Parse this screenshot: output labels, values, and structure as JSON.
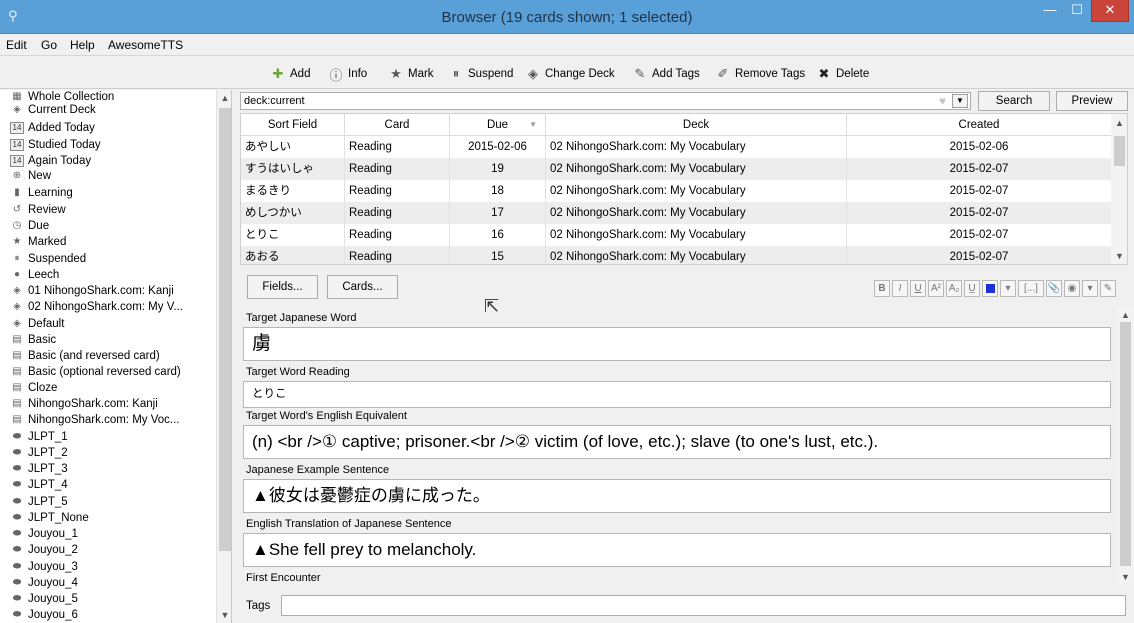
{
  "window": {
    "title": "Browser (19 cards shown; 1 selected)",
    "min_glyph": "—",
    "max_glyph": "☐",
    "close_glyph": "✕"
  },
  "menu": [
    "Edit",
    "Go",
    "Help",
    "AwesomeTTS"
  ],
  "toolbar": [
    {
      "label": "Add",
      "icon": "add-icon"
    },
    {
      "label": "Info",
      "icon": "info-icon"
    },
    {
      "label": "Mark",
      "icon": "star-icon"
    },
    {
      "label": "Suspend",
      "icon": "pause-icon"
    },
    {
      "label": "Change Deck",
      "icon": "deck-icon"
    },
    {
      "label": "Add Tags",
      "icon": "tag-icon"
    },
    {
      "label": "Remove Tags",
      "icon": "remove-tag-icon"
    },
    {
      "label": "Delete",
      "icon": "delete-icon"
    }
  ],
  "sidebar": {
    "items": [
      {
        "label": "Whole Collection",
        "icon": "collection-icon"
      },
      {
        "label": "Current Deck",
        "icon": "deck-icon"
      },
      {
        "label": "Added Today",
        "icon": "calendar-icon",
        "badge": "14"
      },
      {
        "label": "Studied Today",
        "icon": "calendar-icon",
        "badge": "14"
      },
      {
        "label": "Again Today",
        "icon": "calendar-icon",
        "badge": "14"
      },
      {
        "label": "New",
        "icon": "new-icon"
      },
      {
        "label": "Learning",
        "icon": "learning-icon"
      },
      {
        "label": "Review",
        "icon": "review-icon"
      },
      {
        "label": "Due",
        "icon": "clock-icon"
      },
      {
        "label": "Marked",
        "icon": "star-icon"
      },
      {
        "label": "Suspended",
        "icon": "pause-icon"
      },
      {
        "label": "Leech",
        "icon": "leech-icon"
      },
      {
        "label": "01 NihongoShark.com: Kanji",
        "icon": "deck-icon"
      },
      {
        "label": "02 NihongoShark.com: My V...",
        "icon": "deck-icon"
      },
      {
        "label": "Default",
        "icon": "deck-icon"
      },
      {
        "label": "Basic",
        "icon": "note-type-icon"
      },
      {
        "label": "Basic (and reversed card)",
        "icon": "note-type-icon"
      },
      {
        "label": "Basic (optional reversed card)",
        "icon": "note-type-icon"
      },
      {
        "label": "Cloze",
        "icon": "note-type-icon"
      },
      {
        "label": "NihongoShark.com: Kanji",
        "icon": "note-type-icon"
      },
      {
        "label": "NihongoShark.com: My Voc...",
        "icon": "note-type-icon"
      },
      {
        "label": "JLPT_1",
        "icon": "tag-icon"
      },
      {
        "label": "JLPT_2",
        "icon": "tag-icon"
      },
      {
        "label": "JLPT_3",
        "icon": "tag-icon"
      },
      {
        "label": "JLPT_4",
        "icon": "tag-icon"
      },
      {
        "label": "JLPT_5",
        "icon": "tag-icon"
      },
      {
        "label": "JLPT_None",
        "icon": "tag-icon"
      },
      {
        "label": "Jouyou_1",
        "icon": "tag-icon"
      },
      {
        "label": "Jouyou_2",
        "icon": "tag-icon"
      },
      {
        "label": "Jouyou_3",
        "icon": "tag-icon"
      },
      {
        "label": "Jouyou_4",
        "icon": "tag-icon"
      },
      {
        "label": "Jouyou_5",
        "icon": "tag-icon"
      },
      {
        "label": "Jouyou_6",
        "icon": "tag-icon"
      }
    ]
  },
  "search": {
    "value": "deck:current",
    "button": "Search",
    "preview": "Preview"
  },
  "table": {
    "headers": [
      "Sort Field",
      "Card",
      "Due",
      "Deck",
      "Created"
    ],
    "rows": [
      [
        "あやしい",
        "Reading",
        "2015-02-06",
        "02 NihongoShark.com: My Vocabulary",
        "2015-02-06"
      ],
      [
        "すうはいしゃ",
        "Reading",
        "19",
        "02 NihongoShark.com: My Vocabulary",
        "2015-02-07"
      ],
      [
        "まるきり",
        "Reading",
        "18",
        "02 NihongoShark.com: My Vocabulary",
        "2015-02-07"
      ],
      [
        "めしつかい",
        "Reading",
        "17",
        "02 NihongoShark.com: My Vocabulary",
        "2015-02-07"
      ],
      [
        "とりこ",
        "Reading",
        "16",
        "02 NihongoShark.com: My Vocabulary",
        "2015-02-07"
      ],
      [
        "あおる",
        "Reading",
        "15",
        "02 NihongoShark.com: My Vocabulary",
        "2015-02-07"
      ]
    ]
  },
  "editor": {
    "fields_button": "Fields...",
    "cards_button": "Cards...",
    "format_buttons": [
      "B",
      "I",
      "U",
      "A²",
      "A₂",
      "U̲",
      "■",
      "▾",
      "[...]",
      "📎",
      "◉",
      "▾",
      "✎"
    ],
    "fields": [
      {
        "label": "Target Japanese Word",
        "value": "虜"
      },
      {
        "label": "Target Word Reading",
        "value": "とりこ"
      },
      {
        "label": "Target Word's English Equivalent",
        "value": "(n) <br />① captive; prisoner.<br />② victim (of love, etc.); slave (to one's lust, etc.)."
      },
      {
        "label": "Japanese Example Sentence",
        "value": "▲彼女は憂鬱症の虜に成った。"
      },
      {
        "label": "English Translation of Japanese Sentence",
        "value": "▲She fell prey to melancholy."
      },
      {
        "label": "First Encounter",
        "value": ""
      }
    ],
    "tags_label": "Tags",
    "tags_value": ""
  },
  "colors": {
    "titlebar": "#5aa0d8",
    "close": "#c9453a",
    "row_alt": "#ededed",
    "text_color_swatch": "#1c2fd8"
  }
}
